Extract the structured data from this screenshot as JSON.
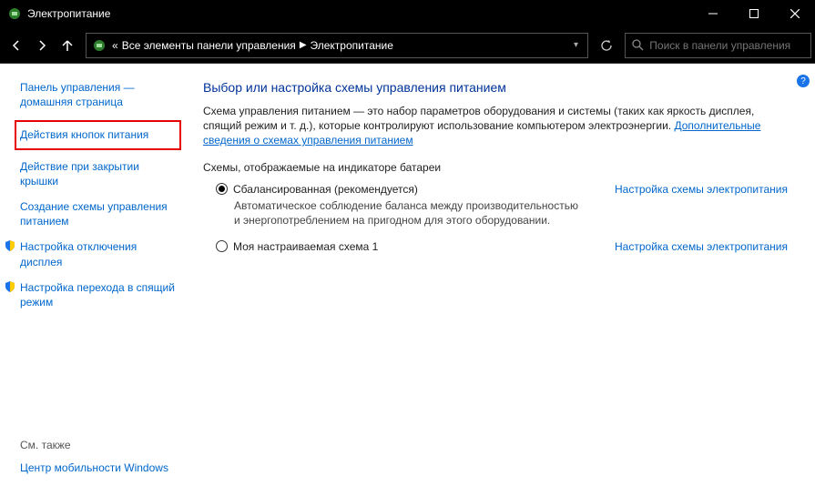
{
  "window": {
    "title": "Электропитание"
  },
  "breadcrumb": {
    "prefix": "«",
    "parent": "Все элементы панели управления",
    "current": "Электропитание"
  },
  "search": {
    "placeholder": "Поиск в панели управления"
  },
  "sidebar": {
    "home": "Панель управления — домашняя страница",
    "items": [
      "Действия кнопок питания",
      "Действие при закрытии крышки",
      "Создание схемы управления питанием",
      "Настройка отключения дисплея",
      "Настройка перехода в спящий режим"
    ],
    "see_also_label": "См. также",
    "see_also_link": "Центр мобильности Windows"
  },
  "main": {
    "heading": "Выбор или настройка схемы управления питанием",
    "description": "Схема управления питанием — это набор параметров оборудования и системы (таких как яркость дисплея, спящий режим и т. д.), которые контролируют использование компьютером электроэнергии.",
    "more_link": "Дополнительные сведения о схемах управления питанием",
    "section_label": "Схемы, отображаемые на индикаторе батареи",
    "plan_link_label": "Настройка схемы электропитания",
    "plans": [
      {
        "name": "Сбалансированная (рекомендуется)",
        "checked": true,
        "desc": "Автоматическое соблюдение баланса между производительностью и энергопотреблением на пригодном для этого оборудовании."
      },
      {
        "name": "Моя настраиваемая схема 1",
        "checked": false,
        "desc": ""
      }
    ]
  }
}
